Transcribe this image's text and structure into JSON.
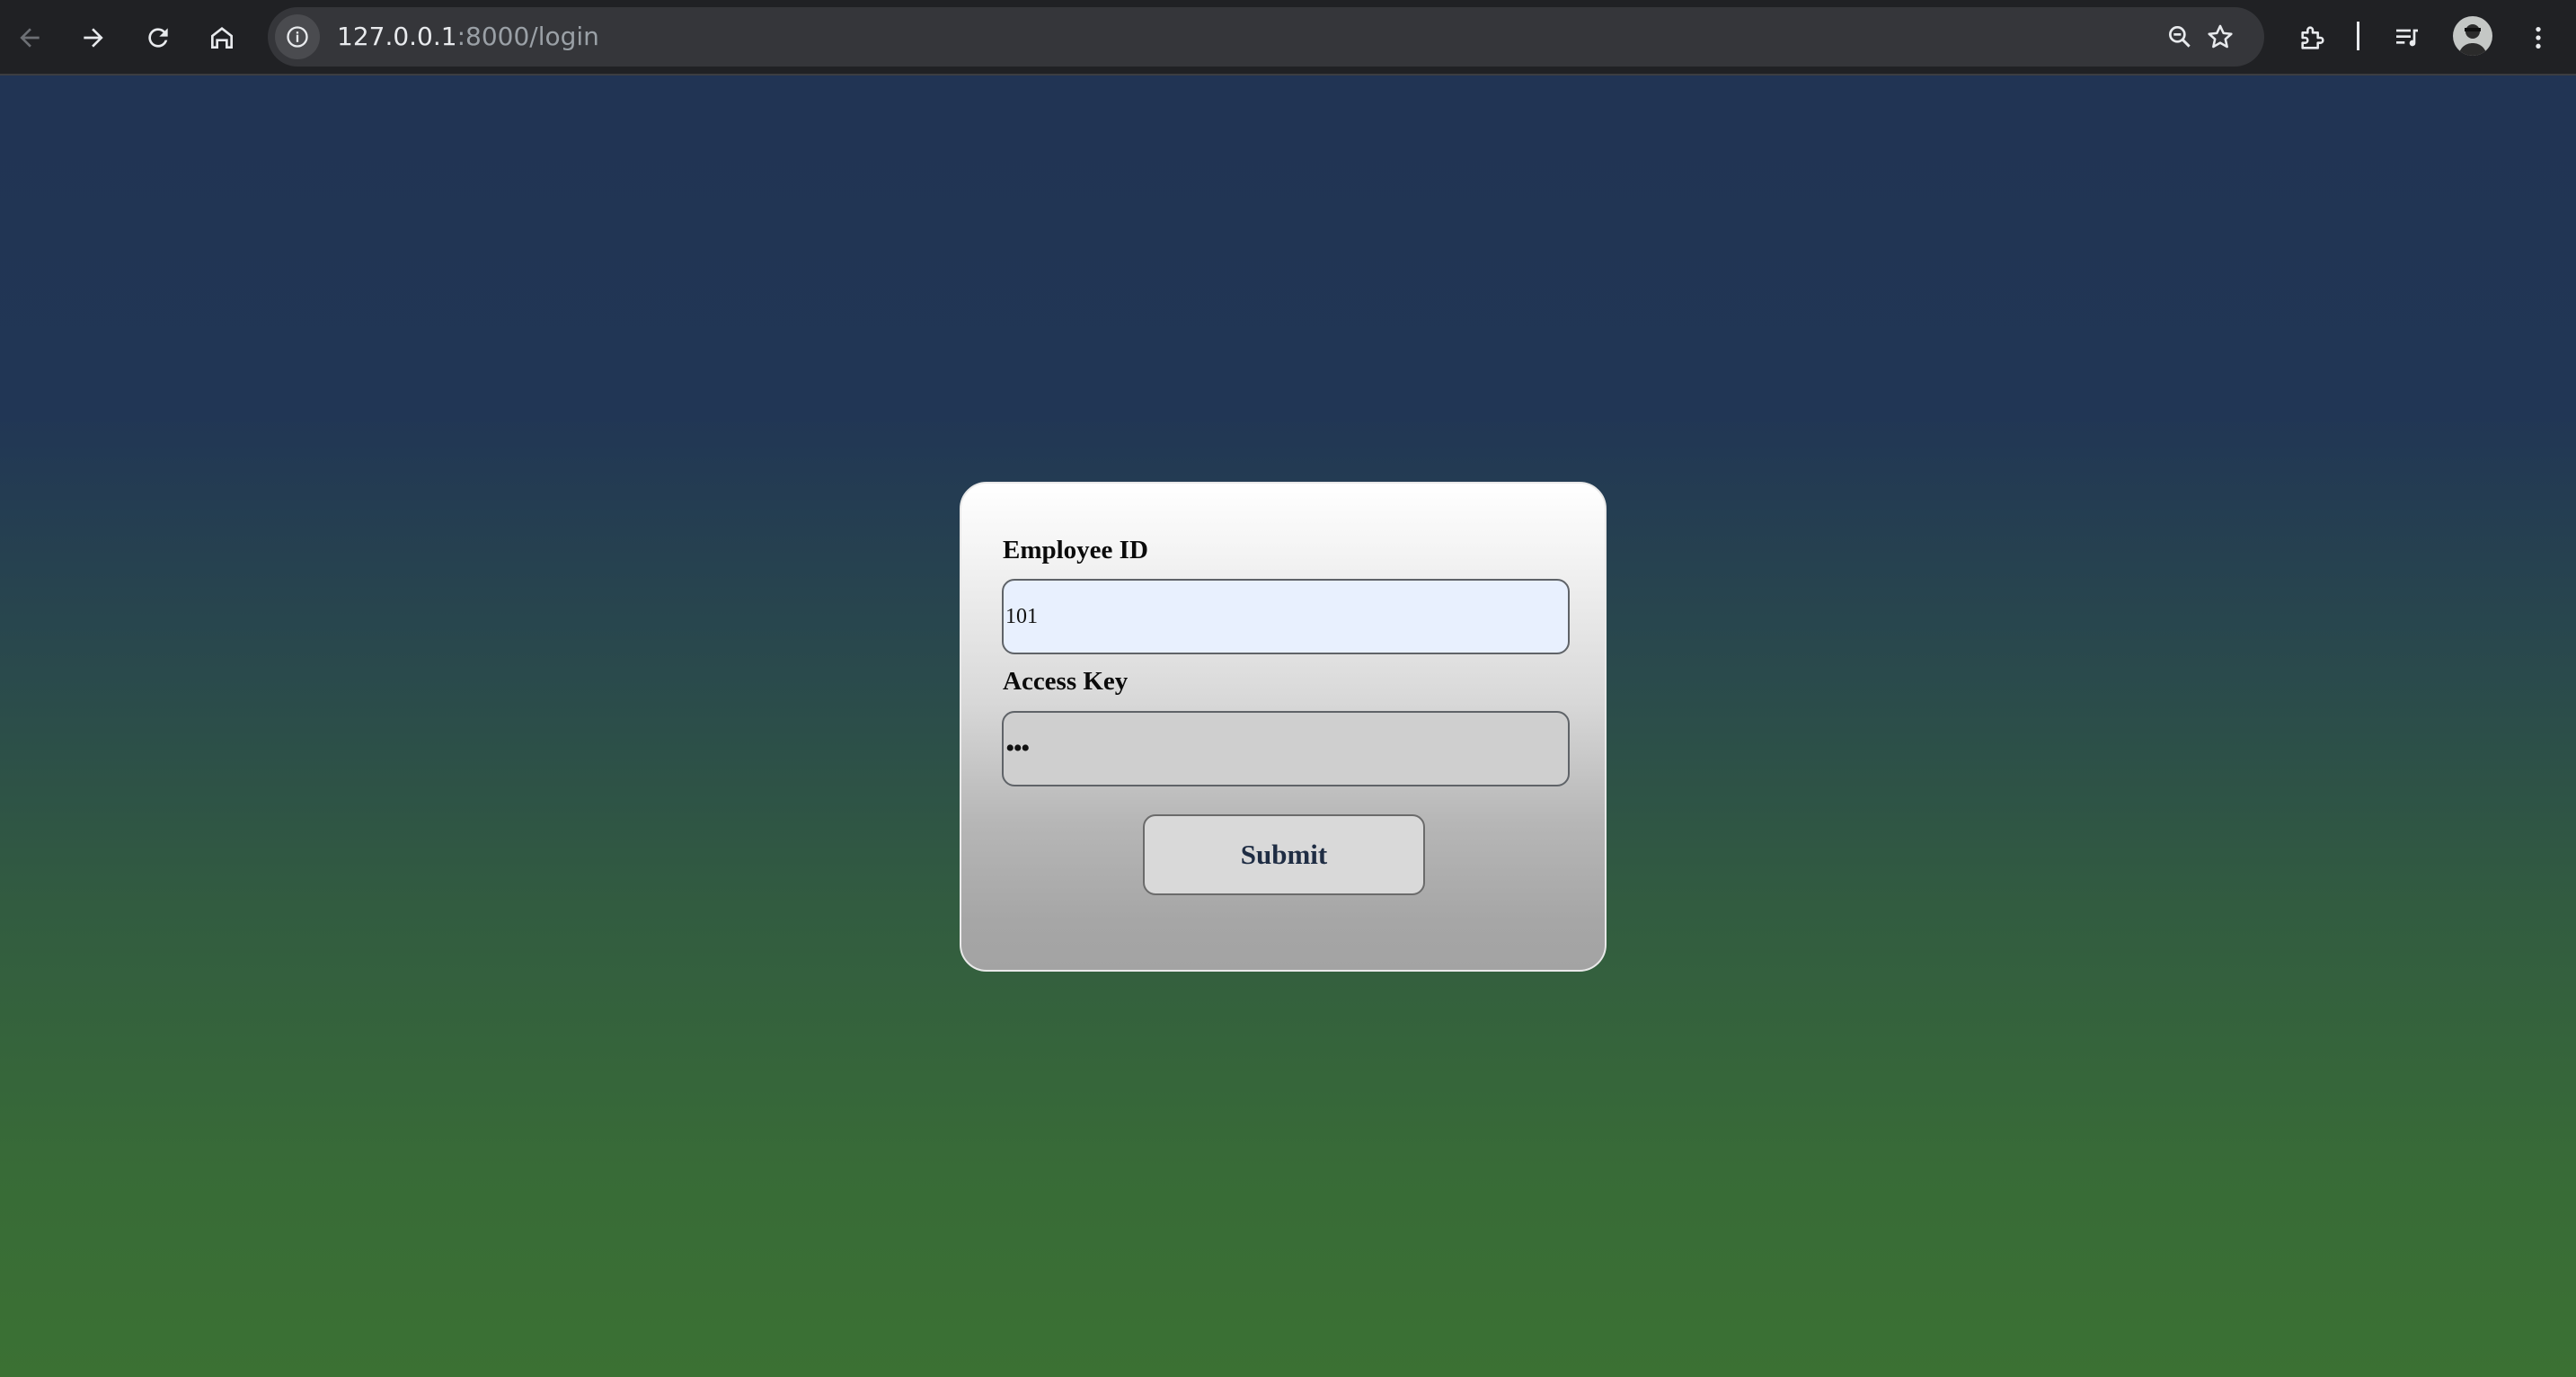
{
  "browser": {
    "url_host": "127.0.0.1",
    "url_path": ":8000/login",
    "icons": [
      "back-arrow-icon",
      "forward-arrow-icon",
      "reload-icon",
      "home-icon",
      "site-info-icon",
      "zoom-icon",
      "bookmark-star-icon",
      "extensions-icon",
      "media-control-icon",
      "profile-avatar",
      "more-menu-icon"
    ]
  },
  "login_form": {
    "employee_id_label": "Employee ID",
    "employee_id_value": "101",
    "access_key_label": "Access Key",
    "access_key_value": "•••",
    "submit_label": "Submit"
  },
  "colors": {
    "background_top": "#213454",
    "background_bottom": "#3b7133",
    "submit_text": "#1f2d44",
    "autofill_input": "#e8f0fe"
  }
}
